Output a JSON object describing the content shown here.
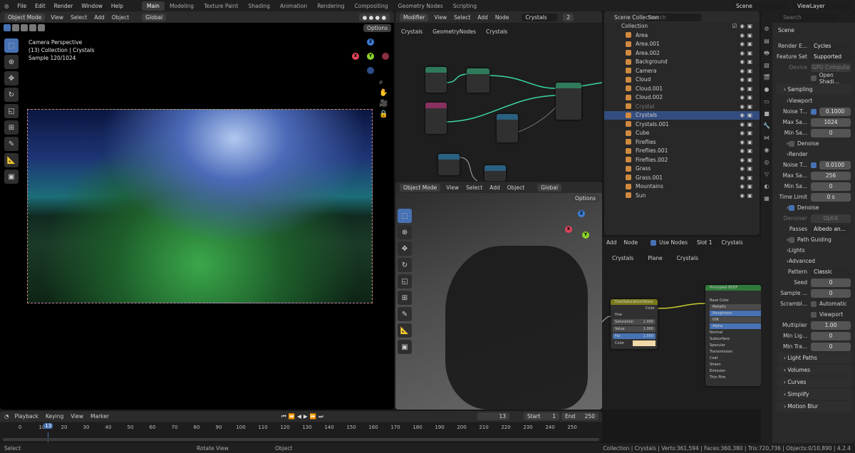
{
  "topbar": {
    "menus": [
      "File",
      "Edit",
      "Render",
      "Window",
      "Help"
    ],
    "workspaces": [
      "Main",
      "Modeling",
      "Texture Paint",
      "Shading",
      "Animation",
      "Rendering",
      "Compositing",
      "Geometry Nodes",
      "Scripting"
    ],
    "active_workspace": "Main",
    "scene": "Scene",
    "view_layer": "ViewLayer"
  },
  "viewport_main": {
    "mode": "Object Mode",
    "menus": [
      "View",
      "Select",
      "Add",
      "Object"
    ],
    "orientation": "Global",
    "options": "Options",
    "overlay": [
      "Camera Perspective",
      "(13) Collection | Crystals",
      "Sample 120/1024"
    ]
  },
  "geonodes": {
    "editor": "Modifier",
    "menus": [
      "View",
      "Select",
      "Add",
      "Node"
    ],
    "tree": "Crystals",
    "users": "2",
    "breadcrumb": [
      "Crystals",
      "GeometryNodes",
      "Crystals"
    ]
  },
  "viewport_solid": {
    "mode": "Object Mode",
    "menus": [
      "View",
      "Select",
      "Add",
      "Object"
    ],
    "orientation": "Global",
    "options": "Options"
  },
  "outliner": {
    "search_placeholder": "Search",
    "scene_collection": "Scene Collection",
    "collection": "Collection",
    "items": [
      {
        "name": "Area"
      },
      {
        "name": "Area.001"
      },
      {
        "name": "Area.002"
      },
      {
        "name": "Background"
      },
      {
        "name": "Camera"
      },
      {
        "name": "Cloud"
      },
      {
        "name": "Cloud.001"
      },
      {
        "name": "Cloud.002"
      },
      {
        "name": "Crystal",
        "dim": true
      },
      {
        "name": "Crystals",
        "selected": true
      },
      {
        "name": "Crystals.001"
      },
      {
        "name": "Cube"
      },
      {
        "name": "Fireflies"
      },
      {
        "name": "Fireflies.001"
      },
      {
        "name": "Fireflies.002"
      },
      {
        "name": "Grass"
      },
      {
        "name": "Grass.001"
      },
      {
        "name": "Mountains"
      },
      {
        "name": "Sun"
      }
    ]
  },
  "shader": {
    "menus": [
      "Add",
      "Node"
    ],
    "use_nodes": "Use Nodes",
    "slot": "Slot 1",
    "material": "Crystals",
    "breadcrumb": [
      "Crystals",
      "Plane",
      "Crystals"
    ],
    "hsv_node": {
      "title": "Hue/Saturation/Value",
      "out": "Color",
      "rows": [
        [
          "Hue",
          ""
        ],
        [
          "Saturation",
          "1.000"
        ],
        [
          "Value",
          "1.000"
        ],
        [
          "Fac",
          "1.000"
        ],
        [
          "Color",
          ""
        ]
      ]
    },
    "bsdf_node": {
      "title": "Principled BSDF",
      "rows": [
        "Base Color",
        "Metallic",
        "Roughness",
        "IOR",
        "Alpha",
        "Normal",
        "Subsurface",
        "Specular",
        "Transmission",
        "Coat",
        "Sheen",
        "Emission",
        "Thin Film"
      ]
    }
  },
  "properties": {
    "search_placeholder": "Search",
    "context": "Scene",
    "rows": [
      {
        "t": "f",
        "l": "Render E...",
        "v": "Cycles",
        "sel": true
      },
      {
        "t": "f",
        "l": "Feature Set",
        "v": "Supported",
        "sel": true
      },
      {
        "t": "f",
        "l": "Device",
        "v": "GPU Compute",
        "dim": true
      },
      {
        "t": "c",
        "v": "Open Shadi..."
      },
      {
        "t": "s",
        "v": "Sampling"
      },
      {
        "t": "h",
        "v": "Viewport"
      },
      {
        "t": "f",
        "l": "Noise T...",
        "v": "0.1000",
        "chk": true
      },
      {
        "t": "f",
        "l": "Max Sa...",
        "v": "1024"
      },
      {
        "t": "f",
        "l": "Min Sa...",
        "v": "0"
      },
      {
        "t": "h",
        "v": "Denoise",
        "chk": false
      },
      {
        "t": "h",
        "v": "Render"
      },
      {
        "t": "f",
        "l": "Noise T...",
        "v": "0.0100",
        "chk": true
      },
      {
        "t": "f",
        "l": "Max Sa...",
        "v": "256"
      },
      {
        "t": "f",
        "l": "Min Sa...",
        "v": "0"
      },
      {
        "t": "f",
        "l": "Time Limit",
        "v": "0 s"
      },
      {
        "t": "h",
        "v": "Denoise",
        "chk": true
      },
      {
        "t": "f",
        "l": "Denoiser",
        "v": "OptiX",
        "dim": true
      },
      {
        "t": "f",
        "l": "Passes",
        "v": "Albedo an...",
        "sel": true
      },
      {
        "t": "h",
        "v": "Path Guiding",
        "chk": false
      },
      {
        "t": "h",
        "v": "Lights"
      },
      {
        "t": "h",
        "v": "Advanced"
      },
      {
        "t": "f",
        "l": "Pattern",
        "v": "Classic",
        "sel": true
      },
      {
        "t": "f",
        "l": "Seed",
        "v": "0"
      },
      {
        "t": "f",
        "l": "Sample ...",
        "v": "0"
      },
      {
        "t": "c",
        "l": "Scrambl...",
        "v": "Automatic"
      },
      {
        "t": "c",
        "v": "Viewport"
      },
      {
        "t": "f",
        "l": "Multiplier",
        "v": "1.00"
      },
      {
        "t": "f",
        "l": "Min Lig...",
        "v": "0"
      },
      {
        "t": "f",
        "l": "Min Tra...",
        "v": "0"
      },
      {
        "t": "s",
        "v": "Light Paths"
      },
      {
        "t": "s",
        "v": "Volumes"
      },
      {
        "t": "s",
        "v": "Curves"
      },
      {
        "t": "s",
        "v": "Simplify"
      },
      {
        "t": "s",
        "v": "Motion Blur"
      }
    ]
  },
  "timeline": {
    "menus": [
      "Playback",
      "Keying",
      "View",
      "Marker"
    ],
    "current_frame": "13",
    "start_label": "Start",
    "start": "1",
    "end_label": "End",
    "end": "250",
    "ticks": [
      "0",
      "10",
      "20",
      "30",
      "40",
      "50",
      "60",
      "70",
      "80",
      "90",
      "100",
      "110",
      "120",
      "130",
      "140",
      "150",
      "160",
      "170",
      "180",
      "190",
      "200",
      "210",
      "220",
      "230",
      "240",
      "250"
    ]
  },
  "statusbar": {
    "hints": [
      "Select",
      "Rotate View",
      "Object"
    ],
    "stats": "Collection | Crystals | Verts:361,594 | Faces:360,380 | Tris:720,736 | Objects:0/10,890 | 4.2.4"
  },
  "colors": {
    "accent": "#4772b3",
    "axis_x": "#e0455a",
    "axis_y": "#8bd22a",
    "axis_z": "#3d7dd8",
    "node_green": "#2f7a3a",
    "node_yellow": "#8a8a20"
  }
}
